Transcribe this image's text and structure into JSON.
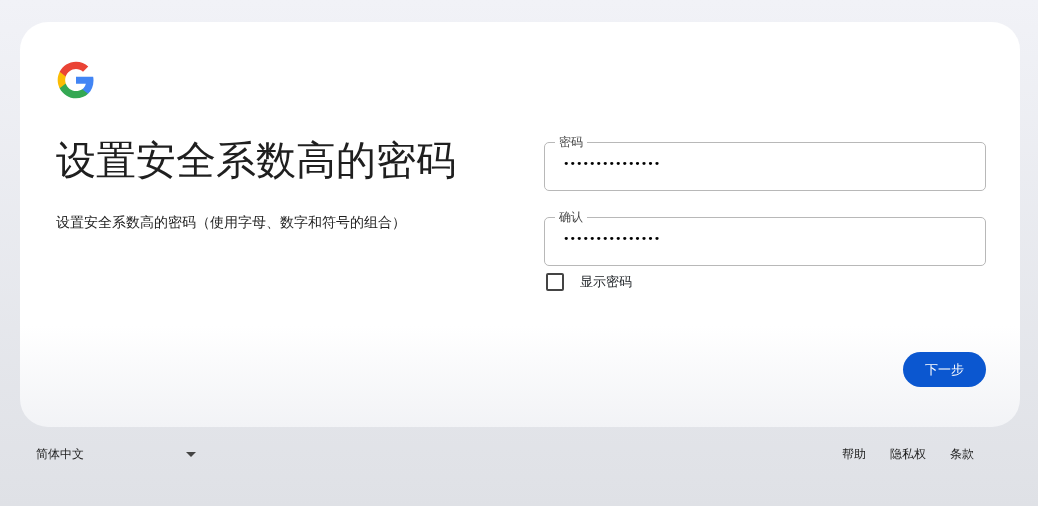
{
  "card": {
    "title": "设置安全系数高的密码",
    "subtitle": "设置安全系数高的密码（使用字母、数字和符号的组合）",
    "fields": [
      {
        "label": "密码",
        "value": "•••••••••••••••"
      },
      {
        "label": "确认",
        "value": "•••••••••••••••"
      }
    ],
    "show_password": {
      "label": "显示密码",
      "checked": false
    },
    "next_button": "下一步"
  },
  "footer": {
    "language": "简体中文",
    "links": [
      "帮助",
      "隐私权",
      "条款"
    ]
  }
}
